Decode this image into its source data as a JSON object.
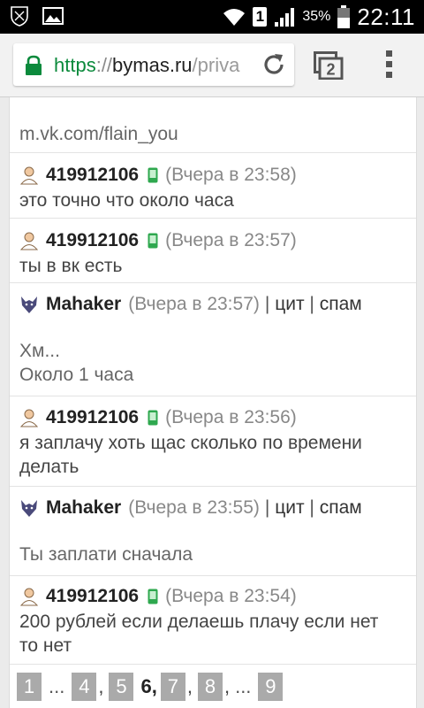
{
  "status": {
    "battery_pct": "35%",
    "time": "22:11",
    "sim": "1"
  },
  "browser": {
    "url_scheme": "https",
    "url_sep": "://",
    "url_host": "bymas.ru",
    "url_path": "/priva",
    "tab_count": "2"
  },
  "top_text": "m.vk.com/flain_you",
  "messages": [
    {
      "nick": "419912106",
      "time": "(Вчера в 23:58)",
      "text": "это точно что около часа"
    },
    {
      "nick": "419912106",
      "time": "(Вчера в 23:57)",
      "text": "ты в вк есть"
    },
    {
      "nick": "Mahaker",
      "time": "(Вчера в 23:57)",
      "quote": "цит",
      "spam": "спам",
      "bar": "|",
      "text1": "Хм...",
      "text2": "Около 1 часа"
    },
    {
      "nick": "419912106",
      "time": "(Вчера в 23:56)",
      "text1": "я заплачу хоть щас сколько по времени",
      "text2": "делать"
    },
    {
      "nick": "Mahaker",
      "time": "(Вчера в 23:55)",
      "quote": "цит",
      "spam": "спам",
      "bar": "|",
      "text": "Ты заплати сначала"
    },
    {
      "nick": "419912106",
      "time": "(Вчера в 23:54)",
      "text1": "200 рублей если делаешь плачу если нет",
      "text2": "то нет"
    }
  ],
  "pager": {
    "p1": "1",
    "dots": "...",
    "p4": "4",
    "p5": "5",
    "current": "6,",
    "p7": "7",
    "p8": "8",
    "p9": "9",
    "comma": ","
  },
  "colors": {
    "https_green": "#0b8a3c",
    "page_button": "#aaaaaa",
    "phone_green": "#2fa84f"
  }
}
